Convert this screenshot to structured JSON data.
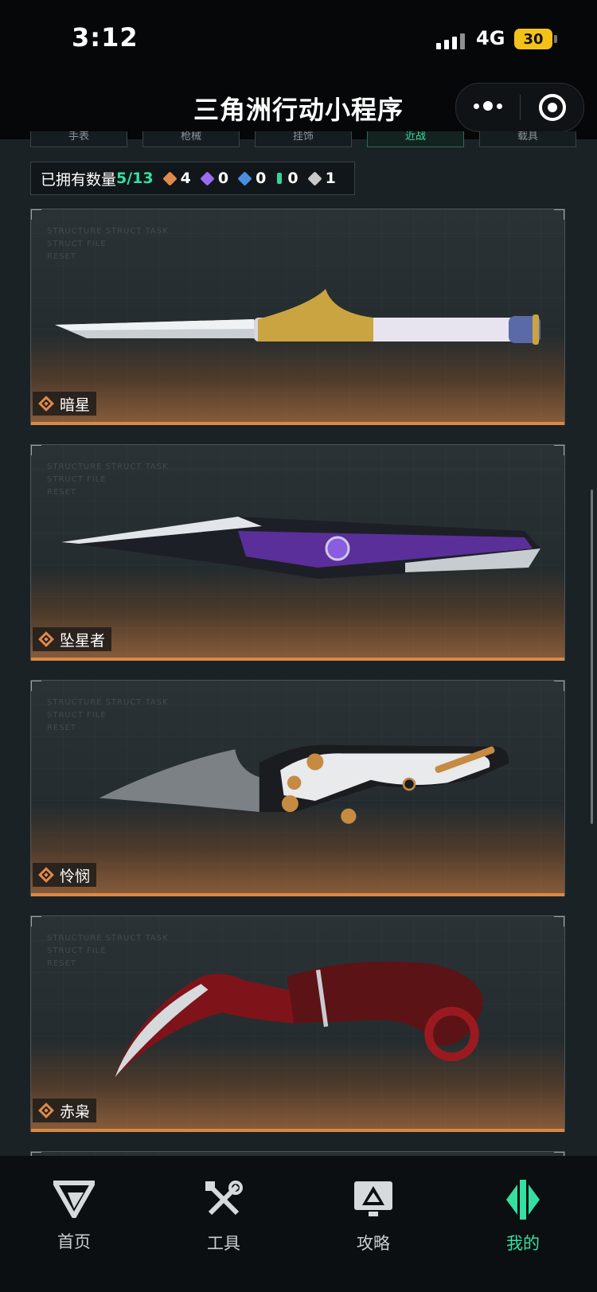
{
  "status": {
    "time": "3:12",
    "network": "4G",
    "battery": "30"
  },
  "header": {
    "title": "三角洲行动小程序"
  },
  "category_tabs": [
    {
      "label": "手表",
      "active": false
    },
    {
      "label": "枪械",
      "active": false
    },
    {
      "label": "挂饰",
      "active": false
    },
    {
      "label": "近战",
      "active": true
    },
    {
      "label": "载具",
      "active": false
    }
  ],
  "owned": {
    "label": "已拥有数量",
    "count": "5/13",
    "rarities": [
      {
        "icon": "orange-gem-icon",
        "color": "#e08a4a",
        "count": "4"
      },
      {
        "icon": "purple-gem-icon",
        "color": "#9b6cf0",
        "count": "0"
      },
      {
        "icon": "blue-gem-icon",
        "color": "#4a8ee0",
        "count": "0"
      },
      {
        "icon": "green-gem-icon",
        "color": "#34d39a",
        "count": "0"
      },
      {
        "icon": "gray-gem-icon",
        "color": "#c9c9c9",
        "count": "1"
      }
    ]
  },
  "items": [
    {
      "name": "暗星",
      "rarity_color": "#e08a4a"
    },
    {
      "name": "坠星者",
      "rarity_color": "#e08a4a"
    },
    {
      "name": "怜悯",
      "rarity_color": "#e08a4a"
    },
    {
      "name": "赤枭",
      "rarity_color": "#e08a4a"
    }
  ],
  "card_watermark": [
    "STRUCTURE STRUCT TASK",
    "STRUCT FILE",
    "RESET"
  ],
  "tabbar": [
    {
      "label": "首页",
      "icon": "home-logo-icon",
      "active": false
    },
    {
      "label": "工具",
      "icon": "tools-icon",
      "active": false
    },
    {
      "label": "攻略",
      "icon": "guide-monitor-icon",
      "active": false
    },
    {
      "label": "我的",
      "icon": "profile-logo-icon",
      "active": true
    }
  ],
  "colors": {
    "accent": "#34e0a1",
    "card_orange": "#d98a48"
  }
}
